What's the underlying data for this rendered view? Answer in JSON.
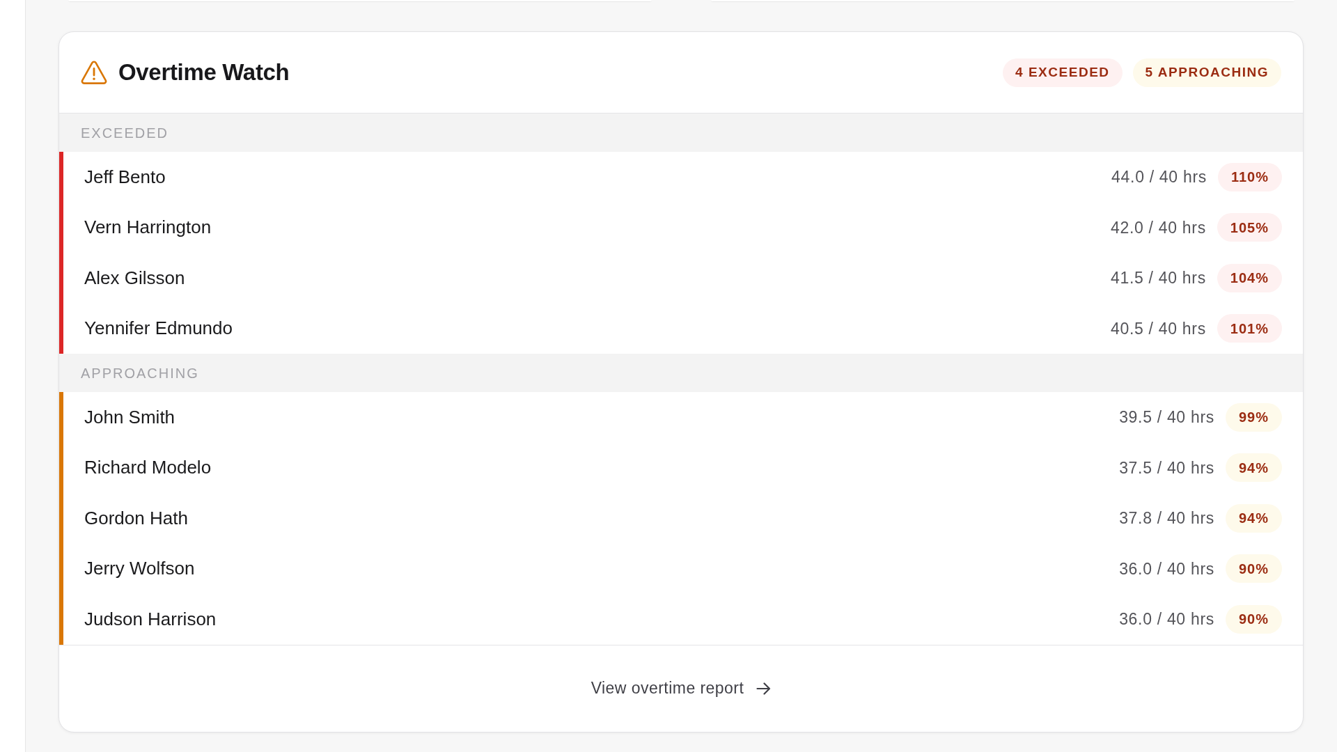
{
  "card": {
    "title": "Overtime Watch",
    "summary_badges": [
      {
        "kind": "exceeded",
        "label": "4 EXCEEDED"
      },
      {
        "kind": "approaching",
        "label": "5 APPROACHING"
      }
    ],
    "sections": [
      {
        "kind": "exceeded",
        "heading": "EXCEEDED",
        "employees": [
          {
            "name": "Jeff Bento",
            "hours": "44.0 / 40 hrs",
            "percent": "110%"
          },
          {
            "name": "Vern Harrington",
            "hours": "42.0 / 40 hrs",
            "percent": "105%"
          },
          {
            "name": "Alex Gilsson",
            "hours": "41.5 / 40 hrs",
            "percent": "104%"
          },
          {
            "name": "Yennifer Edmundo",
            "hours": "40.5 / 40 hrs",
            "percent": "101%"
          }
        ]
      },
      {
        "kind": "approaching",
        "heading": "APPROACHING",
        "employees": [
          {
            "name": "John Smith",
            "hours": "39.5 / 40 hrs",
            "percent": "99%"
          },
          {
            "name": "Richard Modelo",
            "hours": "37.5 / 40 hrs",
            "percent": "94%"
          },
          {
            "name": "Gordon Hath",
            "hours": "37.8 / 40 hrs",
            "percent": "94%"
          },
          {
            "name": "Jerry Wolfson",
            "hours": "36.0 / 40 hrs",
            "percent": "90%"
          },
          {
            "name": "Judson Harrison",
            "hours": "36.0 / 40 hrs",
            "percent": "90%"
          }
        ]
      }
    ],
    "footer_link": "View overtime report"
  }
}
